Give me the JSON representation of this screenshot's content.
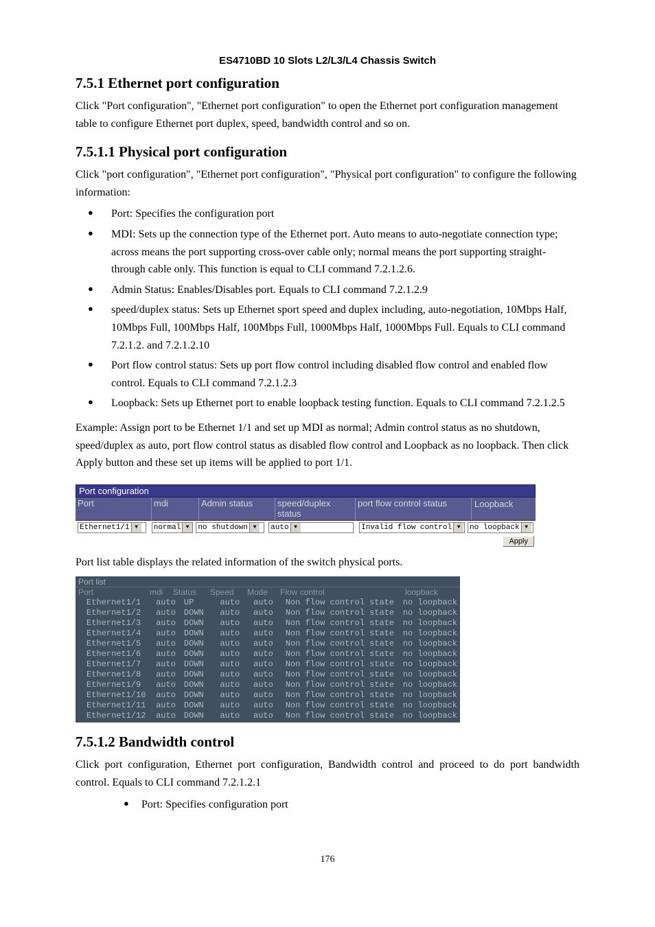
{
  "doc": {
    "header": "ES4710BD 10 Slots L2/L3/L4 Chassis Switch",
    "page_number": "176",
    "section751_title": "7.5.1   Ethernet port configuration",
    "section751_para": "Click \"Port configuration\", \"Ethernet port configuration\" to open the Ethernet port configuration management table to configure Ethernet port duplex, speed, bandwidth control and so on.",
    "section7511_title": "7.5.1.1   Physical port configuration",
    "section7511_intro": "Click \"port configuration\", \"Ethernet port configuration\", \"Physical port configuration\" to configure the following information:",
    "bullets": [
      "Port: Specifies the configuration port",
      "MDI: Sets up the connection type of the Ethernet port. Auto means to auto-negotiate connection type; across means the port supporting cross-over cable only; normal means the port supporting straight-through cable only. This function is equal to CLI command 7.2.1.2.6.",
      "Admin Status: Enables/Disables port. Equals to CLI command 7.2.1.2.9",
      "speed/duplex status: Sets up Ethernet sport speed and duplex including, auto-negotiation, 10Mbps Half, 10Mbps Full, 100Mbps Half, 100Mbps Full, 1000Mbps Half, 1000Mbps Full. Equals to CLI command 7.2.1.2. and 7.2.1.2.10",
      "Port flow control status: Sets up port flow control including disabled flow control and enabled flow control. Equals to CLI command 7.2.1.2.3",
      "Loopback: Sets up Ethernet port to enable loopback testing function. Equals to CLI command 7.2.1.2.5"
    ],
    "example_para": "Example: Assign port to be Ethernet 1/1 and set up MDI as normal; Admin control status as no shutdown, speed/duplex as auto, port flow control status as disabled flow control and Loopback as no loopback. Then click Apply button and these set up items will be applied to port 1/1.",
    "portlist_note": "Port list table displays the related information of the switch physical ports.",
    "section7512_title": "7.5.1.2   Bandwidth control",
    "section7512_para": "Click port configuration, Ethernet port configuration, Bandwidth control and proceed to do port bandwidth control. Equals to CLI command 7.2.1.2.1",
    "section7512_bullets": [
      "Port: Specifies configuration port"
    ]
  },
  "form": {
    "title": "Port configuration",
    "headers": {
      "port": "Port",
      "mdi": "mdi",
      "admin": "Admin status",
      "speed": "speed/duplex status",
      "flow": "port flow control status",
      "loopback": "Loopback"
    },
    "values": {
      "port": "Ethernet1/1",
      "mdi": "normal",
      "admin": "no shutdown",
      "speed": "auto",
      "flow": "Invalid flow control",
      "loopback": "no loopback"
    },
    "apply_label": "Apply"
  },
  "portlist": {
    "title": "Port list",
    "headers": {
      "port": "Port",
      "mdi": "mdi",
      "status": "Status",
      "speed": "Speed",
      "mode": "Mode",
      "flow": "Flow control",
      "loopback": "loopback"
    },
    "rows": [
      {
        "port": "Ethernet1/1",
        "mdi": "auto",
        "status": "UP",
        "speed": "auto",
        "mode": "auto",
        "flow": "Non flow control state",
        "loopback": "no loopback"
      },
      {
        "port": "Ethernet1/2",
        "mdi": "auto",
        "status": "DOWN",
        "speed": "auto",
        "mode": "auto",
        "flow": "Non flow control state",
        "loopback": "no loopback"
      },
      {
        "port": "Ethernet1/3",
        "mdi": "auto",
        "status": "DOWN",
        "speed": "auto",
        "mode": "auto",
        "flow": "Non flow control state",
        "loopback": "no loopback"
      },
      {
        "port": "Ethernet1/4",
        "mdi": "auto",
        "status": "DOWN",
        "speed": "auto",
        "mode": "auto",
        "flow": "Non flow control state",
        "loopback": "no loopback"
      },
      {
        "port": "Ethernet1/5",
        "mdi": "auto",
        "status": "DOWN",
        "speed": "auto",
        "mode": "auto",
        "flow": "Non flow control state",
        "loopback": "no loopback"
      },
      {
        "port": "Ethernet1/6",
        "mdi": "auto",
        "status": "DOWN",
        "speed": "auto",
        "mode": "auto",
        "flow": "Non flow control state",
        "loopback": "no loopback"
      },
      {
        "port": "Ethernet1/7",
        "mdi": "auto",
        "status": "DOWN",
        "speed": "auto",
        "mode": "auto",
        "flow": "Non flow control state",
        "loopback": "no loopback"
      },
      {
        "port": "Ethernet1/8",
        "mdi": "auto",
        "status": "DOWN",
        "speed": "auto",
        "mode": "auto",
        "flow": "Non flow control state",
        "loopback": "no loopback"
      },
      {
        "port": "Ethernet1/9",
        "mdi": "auto",
        "status": "DOWN",
        "speed": "auto",
        "mode": "auto",
        "flow": "Non flow control state",
        "loopback": "no loopback"
      },
      {
        "port": "Ethernet1/10",
        "mdi": "auto",
        "status": "DOWN",
        "speed": "auto",
        "mode": "auto",
        "flow": "Non flow control state",
        "loopback": "no loopback"
      },
      {
        "port": "Ethernet1/11",
        "mdi": "auto",
        "status": "DOWN",
        "speed": "auto",
        "mode": "auto",
        "flow": "Non flow control state",
        "loopback": "no loopback"
      },
      {
        "port": "Ethernet1/12",
        "mdi": "auto",
        "status": "DOWN",
        "speed": "auto",
        "mode": "auto",
        "flow": "Non flow control state",
        "loopback": "no loopback"
      }
    ]
  }
}
